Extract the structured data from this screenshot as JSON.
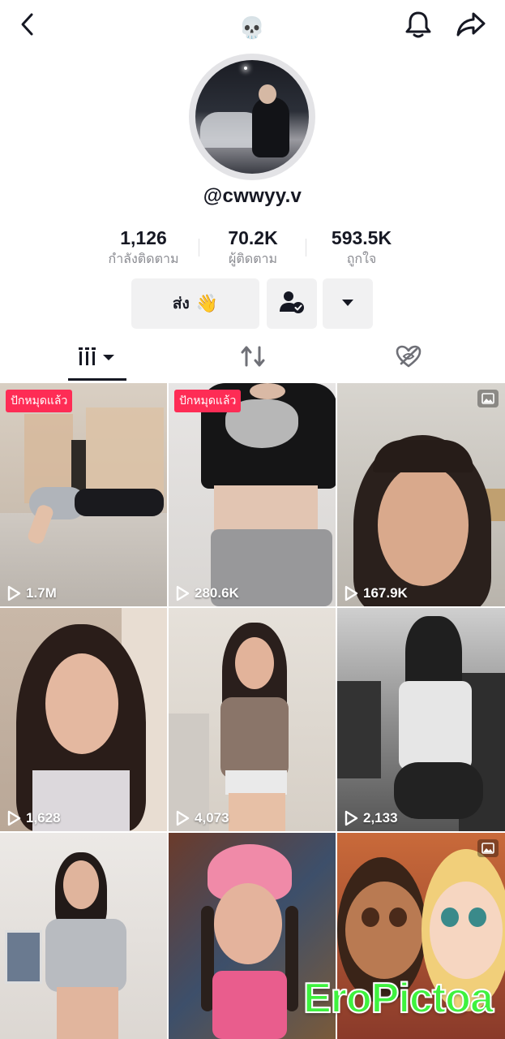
{
  "header": {
    "title_emoji": "💀",
    "back_icon": "chevron-left-icon",
    "bell_icon": "bell-icon",
    "share_icon": "share-arrow-icon"
  },
  "profile": {
    "username": "@cwwyy.v"
  },
  "stats": [
    {
      "value": "1,126",
      "label": "กำลังติดตาม"
    },
    {
      "value": "70.2K",
      "label": "ผู้ติดตาม"
    },
    {
      "value": "593.5K",
      "label": "ถูกใจ"
    }
  ],
  "actions": {
    "message_label": "ส่ง",
    "message_emoji": "👋",
    "follow_icon": "user-check-icon",
    "more_icon": "caret-down-icon"
  },
  "tabs": [
    {
      "name": "videos",
      "icon": "grid-bars-icon",
      "active": true
    },
    {
      "name": "reposts",
      "icon": "repost-icon",
      "active": false
    },
    {
      "name": "liked",
      "icon": "heart-hidden-icon",
      "active": false
    }
  ],
  "videos": [
    {
      "views": "1.7M",
      "pinned": "ปักหมุดแล้ว"
    },
    {
      "views": "280.6K",
      "pinned": "ปักหมุดแล้ว"
    },
    {
      "views": "167.9K",
      "photo": true
    },
    {
      "views": "1,628"
    },
    {
      "views": "4,073"
    },
    {
      "views": "2,133"
    },
    {
      "views": ""
    },
    {
      "views": ""
    },
    {
      "views": "",
      "photo": true
    }
  ],
  "watermark": "EroPictoa",
  "colors": {
    "accent": "#fe2c55",
    "text": "#161823",
    "muted": "#8a8b91",
    "button_bg": "#f1f1f2",
    "watermark": "#3ef23e"
  }
}
